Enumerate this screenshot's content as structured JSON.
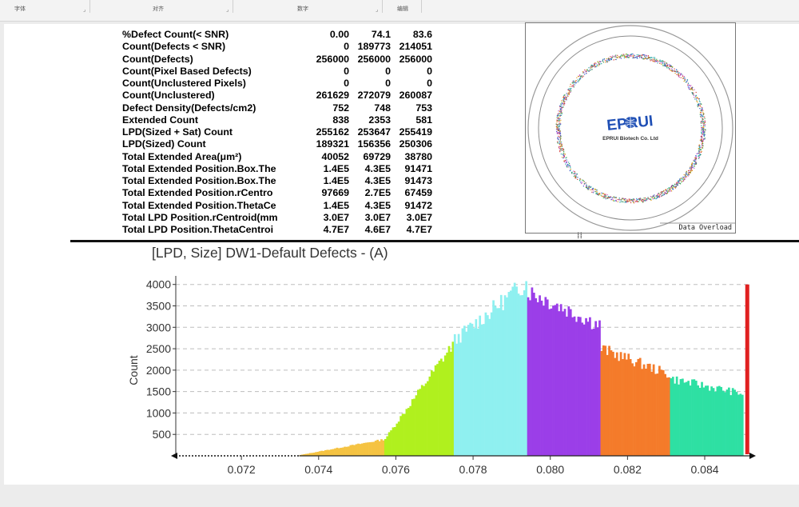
{
  "ribbon": {
    "groups": [
      {
        "label": "字体"
      },
      {
        "label": "对齐"
      },
      {
        "label": "数字"
      },
      {
        "label": "编辑"
      }
    ]
  },
  "stats_table": {
    "rows": [
      {
        "label": "%Defect Count(< SNR)",
        "values": [
          "0.00",
          "74.1",
          "83.6"
        ]
      },
      {
        "label": "Count(Defects < SNR)",
        "values": [
          "0",
          "189773",
          "214051"
        ]
      },
      {
        "label": "Count(Defects)",
        "values": [
          "256000",
          "256000",
          "256000"
        ]
      },
      {
        "label": "Count(Pixel Based Defects)",
        "values": [
          "0",
          "0",
          "0"
        ]
      },
      {
        "label": "Count(Unclustered Pixels)",
        "values": [
          "0",
          "0",
          "0"
        ]
      },
      {
        "label": "Count(Unclustered)",
        "values": [
          "261629",
          "272079",
          "260087"
        ]
      },
      {
        "label": "Defect Density(Defects/cm2)",
        "values": [
          "752",
          "748",
          "753"
        ]
      },
      {
        "label": "Extended Count",
        "values": [
          "838",
          "2353",
          "581"
        ]
      },
      {
        "label": "LPD(Sized + Sat) Count",
        "values": [
          "255162",
          "253647",
          "255419"
        ]
      },
      {
        "label": "LPD(Sized) Count",
        "values": [
          "189321",
          "156356",
          "250306"
        ]
      },
      {
        "label": "Total Extended Area(μm²)",
        "values": [
          "40052",
          "69729",
          "38780"
        ]
      },
      {
        "label": "Total Extended Position.Box.The",
        "values": [
          "1.4E5",
          "4.3E5",
          "91471"
        ]
      },
      {
        "label": "Total Extended Position.Box.The",
        "values": [
          "1.4E5",
          "4.3E5",
          "91473"
        ]
      },
      {
        "label": "Total Extended Position.rCentro",
        "values": [
          "97669",
          "2.7E5",
          "67459"
        ]
      },
      {
        "label": "Total Extended Position.ThetaCe",
        "values": [
          "1.4E5",
          "4.3E5",
          "91472"
        ]
      },
      {
        "label": "Total LPD Position.rCentroid(mm",
        "values": [
          "3.0E7",
          "3.0E7",
          "3.0E7"
        ]
      },
      {
        "label": "Total LPD Position.ThetaCentroi",
        "values": [
          "4.7E7",
          "4.6E7",
          "4.7E7"
        ]
      }
    ]
  },
  "wafer_map": {
    "logo_text": "EPRUI",
    "company_text": "EPRUI Biotech Co. Ltd",
    "status_label": "Data Overload",
    "colors": {
      "ring_red": "#d23a3a",
      "ring_green": "#3fa34d",
      "ring_blue": "#3b5bd0",
      "logo_orange": "#f08a1c",
      "logo_blue": "#1f4fb5"
    }
  },
  "chart_data": {
    "type": "bar",
    "title": "[LPD, Size] DW1-Default Defects - (A)",
    "ylabel": "Count",
    "xlabel": "",
    "xlim": [
      0.0703,
      0.0852
    ],
    "ylim": [
      0,
      4200
    ],
    "grid": "horizontal-dashed",
    "xticks": [
      0.072,
      0.074,
      0.076,
      0.078,
      0.08,
      0.082,
      0.084
    ],
    "xtick_labels": [
      "0.072",
      "0.074",
      "0.076",
      "0.078",
      "0.080",
      "0.082",
      "0.084"
    ],
    "yticks": [
      500,
      1000,
      1500,
      2000,
      2500,
      3000,
      3500,
      4000
    ],
    "ytick_labels": [
      "500",
      "1000",
      "1500",
      "2000",
      "2500",
      "3000",
      "3500",
      "4000"
    ],
    "bin_width": 5e-05,
    "segments": [
      {
        "color": "#f5c342",
        "x_start": 0.0735,
        "x_end": 0.0757,
        "y_start": 20,
        "y_end": 380
      },
      {
        "color": "#b0f01e",
        "x_start": 0.0757,
        "x_end": 0.0775,
        "y_start": 400,
        "y_end": 2600
      },
      {
        "color": "#8ff0f0",
        "x_start": 0.0775,
        "x_end": 0.0794,
        "y_start": 2700,
        "y_end": 4050
      },
      {
        "color": "#9b3ee8",
        "x_start": 0.0794,
        "x_end": 0.0813,
        "y_start": 3850,
        "y_end": 3050
      },
      {
        "color": "#f47b2a",
        "x_start": 0.0813,
        "x_end": 0.0831,
        "y_start": 2500,
        "y_end": 1900
      },
      {
        "color": "#2ee0a3",
        "x_start": 0.0831,
        "x_end": 0.085,
        "y_start": 1800,
        "y_end": 1450
      }
    ],
    "threshold_line": {
      "x": 0.08505,
      "color": "#e02020"
    },
    "baseline_dotted": {
      "x_start": 0.0703,
      "x_end": 0.0735
    }
  }
}
